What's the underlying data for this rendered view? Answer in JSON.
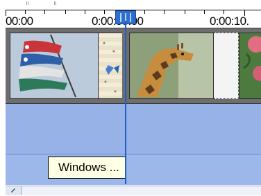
{
  "ruler": {
    "labels": [
      "00:00",
      "0:00:05.00",
      "0:00:10."
    ]
  },
  "tracks": {
    "video_clips": [
      {
        "name": "kites",
        "icon": "kites-thumbnail"
      },
      {
        "name": "giraffe",
        "icon": "giraffe-thumbnail"
      },
      {
        "name": "rose",
        "icon": "rose-thumbnail"
      }
    ]
  },
  "tooltip": {
    "text": "Windows ..."
  },
  "colors": {
    "playhead": "#1e5fc4",
    "track_blue": "#97b2e7",
    "video_track": "#6e6e6e"
  }
}
